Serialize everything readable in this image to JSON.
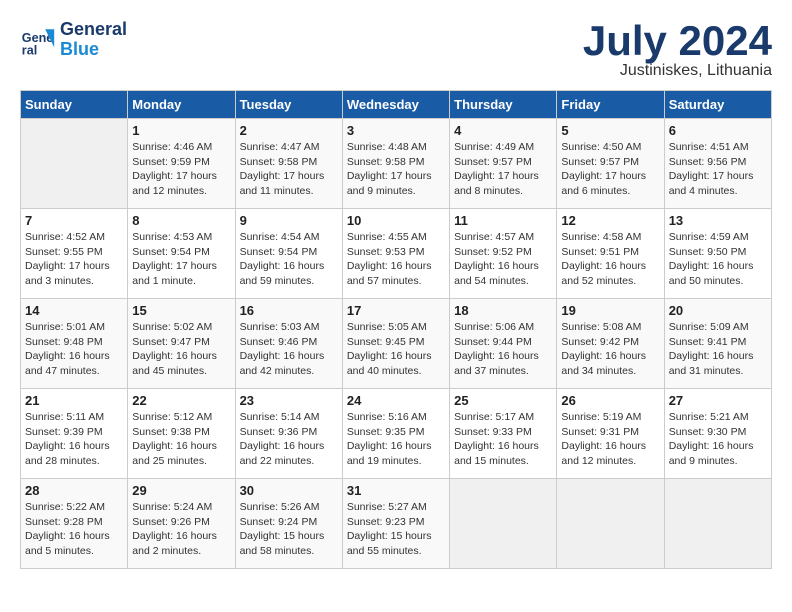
{
  "header": {
    "logo_line1": "General",
    "logo_line2": "Blue",
    "month": "July 2024",
    "location": "Justiniskes, Lithuania"
  },
  "weekdays": [
    "Sunday",
    "Monday",
    "Tuesday",
    "Wednesday",
    "Thursday",
    "Friday",
    "Saturday"
  ],
  "weeks": [
    [
      {
        "day": "",
        "info": ""
      },
      {
        "day": "1",
        "info": "Sunrise: 4:46 AM\nSunset: 9:59 PM\nDaylight: 17 hours\nand 12 minutes."
      },
      {
        "day": "2",
        "info": "Sunrise: 4:47 AM\nSunset: 9:58 PM\nDaylight: 17 hours\nand 11 minutes."
      },
      {
        "day": "3",
        "info": "Sunrise: 4:48 AM\nSunset: 9:58 PM\nDaylight: 17 hours\nand 9 minutes."
      },
      {
        "day": "4",
        "info": "Sunrise: 4:49 AM\nSunset: 9:57 PM\nDaylight: 17 hours\nand 8 minutes."
      },
      {
        "day": "5",
        "info": "Sunrise: 4:50 AM\nSunset: 9:57 PM\nDaylight: 17 hours\nand 6 minutes."
      },
      {
        "day": "6",
        "info": "Sunrise: 4:51 AM\nSunset: 9:56 PM\nDaylight: 17 hours\nand 4 minutes."
      }
    ],
    [
      {
        "day": "7",
        "info": "Sunrise: 4:52 AM\nSunset: 9:55 PM\nDaylight: 17 hours\nand 3 minutes."
      },
      {
        "day": "8",
        "info": "Sunrise: 4:53 AM\nSunset: 9:54 PM\nDaylight: 17 hours\nand 1 minute."
      },
      {
        "day": "9",
        "info": "Sunrise: 4:54 AM\nSunset: 9:54 PM\nDaylight: 16 hours\nand 59 minutes."
      },
      {
        "day": "10",
        "info": "Sunrise: 4:55 AM\nSunset: 9:53 PM\nDaylight: 16 hours\nand 57 minutes."
      },
      {
        "day": "11",
        "info": "Sunrise: 4:57 AM\nSunset: 9:52 PM\nDaylight: 16 hours\nand 54 minutes."
      },
      {
        "day": "12",
        "info": "Sunrise: 4:58 AM\nSunset: 9:51 PM\nDaylight: 16 hours\nand 52 minutes."
      },
      {
        "day": "13",
        "info": "Sunrise: 4:59 AM\nSunset: 9:50 PM\nDaylight: 16 hours\nand 50 minutes."
      }
    ],
    [
      {
        "day": "14",
        "info": "Sunrise: 5:01 AM\nSunset: 9:48 PM\nDaylight: 16 hours\nand 47 minutes."
      },
      {
        "day": "15",
        "info": "Sunrise: 5:02 AM\nSunset: 9:47 PM\nDaylight: 16 hours\nand 45 minutes."
      },
      {
        "day": "16",
        "info": "Sunrise: 5:03 AM\nSunset: 9:46 PM\nDaylight: 16 hours\nand 42 minutes."
      },
      {
        "day": "17",
        "info": "Sunrise: 5:05 AM\nSunset: 9:45 PM\nDaylight: 16 hours\nand 40 minutes."
      },
      {
        "day": "18",
        "info": "Sunrise: 5:06 AM\nSunset: 9:44 PM\nDaylight: 16 hours\nand 37 minutes."
      },
      {
        "day": "19",
        "info": "Sunrise: 5:08 AM\nSunset: 9:42 PM\nDaylight: 16 hours\nand 34 minutes."
      },
      {
        "day": "20",
        "info": "Sunrise: 5:09 AM\nSunset: 9:41 PM\nDaylight: 16 hours\nand 31 minutes."
      }
    ],
    [
      {
        "day": "21",
        "info": "Sunrise: 5:11 AM\nSunset: 9:39 PM\nDaylight: 16 hours\nand 28 minutes."
      },
      {
        "day": "22",
        "info": "Sunrise: 5:12 AM\nSunset: 9:38 PM\nDaylight: 16 hours\nand 25 minutes."
      },
      {
        "day": "23",
        "info": "Sunrise: 5:14 AM\nSunset: 9:36 PM\nDaylight: 16 hours\nand 22 minutes."
      },
      {
        "day": "24",
        "info": "Sunrise: 5:16 AM\nSunset: 9:35 PM\nDaylight: 16 hours\nand 19 minutes."
      },
      {
        "day": "25",
        "info": "Sunrise: 5:17 AM\nSunset: 9:33 PM\nDaylight: 16 hours\nand 15 minutes."
      },
      {
        "day": "26",
        "info": "Sunrise: 5:19 AM\nSunset: 9:31 PM\nDaylight: 16 hours\nand 12 minutes."
      },
      {
        "day": "27",
        "info": "Sunrise: 5:21 AM\nSunset: 9:30 PM\nDaylight: 16 hours\nand 9 minutes."
      }
    ],
    [
      {
        "day": "28",
        "info": "Sunrise: 5:22 AM\nSunset: 9:28 PM\nDaylight: 16 hours\nand 5 minutes."
      },
      {
        "day": "29",
        "info": "Sunrise: 5:24 AM\nSunset: 9:26 PM\nDaylight: 16 hours\nand 2 minutes."
      },
      {
        "day": "30",
        "info": "Sunrise: 5:26 AM\nSunset: 9:24 PM\nDaylight: 15 hours\nand 58 minutes."
      },
      {
        "day": "31",
        "info": "Sunrise: 5:27 AM\nSunset: 9:23 PM\nDaylight: 15 hours\nand 55 minutes."
      },
      {
        "day": "",
        "info": ""
      },
      {
        "day": "",
        "info": ""
      },
      {
        "day": "",
        "info": ""
      }
    ]
  ]
}
